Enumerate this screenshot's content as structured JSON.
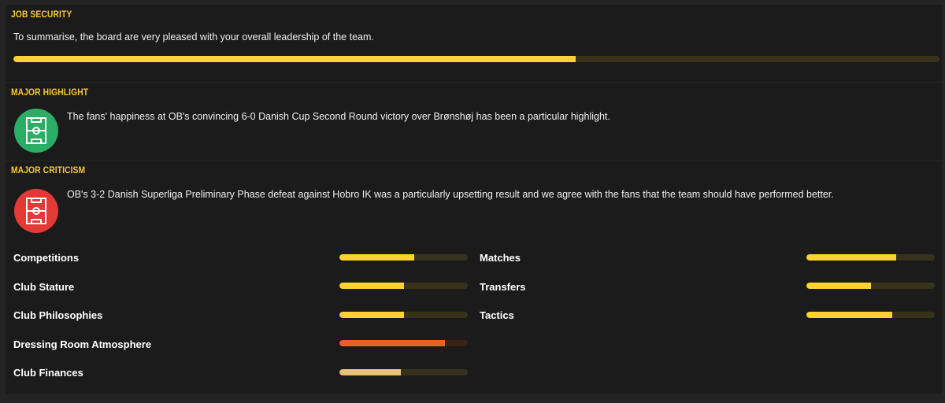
{
  "job_security": {
    "title": "JOB SECURITY",
    "summary": "To summarise, the board are very pleased with your overall leadership of the team.",
    "level": 0.607,
    "bar_color": "#fbd22f"
  },
  "highlight": {
    "title": "MAJOR HIGHLIGHT",
    "text": "The fans' happiness at OB's convincing 6-0 Danish Cup Second Round victory over Brønshøj has been a particular highlight.",
    "icon": "pitch-icon",
    "color": "#2cad66"
  },
  "criticism": {
    "title": "MAJOR CRITICISM",
    "text": "OB's 3-2 Danish Superliga Preliminary Phase defeat against Hobro IK was a particularly upsetting result and we agree with the fans that the team should have performed better.",
    "icon": "pitch-icon",
    "color": "#e23a34"
  },
  "metrics_left": [
    {
      "label": "Competitions",
      "level": 0.58,
      "color": "#fbd22f"
    },
    {
      "label": "Club Stature",
      "level": 0.5,
      "color": "#fbd22f"
    },
    {
      "label": "Club Philosophies",
      "level": 0.5,
      "color": "#fbd22f"
    },
    {
      "label": "Dressing Room Atmosphere",
      "level": 0.82,
      "color": "#e6602a"
    },
    {
      "label": "Club Finances",
      "level": 0.48,
      "color": "#e8c07a"
    }
  ],
  "metrics_right": [
    {
      "label": "Matches",
      "level": 0.7,
      "color": "#fbd22f"
    },
    {
      "label": "Transfers",
      "level": 0.5,
      "color": "#fbd22f"
    },
    {
      "label": "Tactics",
      "level": 0.67,
      "color": "#fbd22f"
    }
  ]
}
